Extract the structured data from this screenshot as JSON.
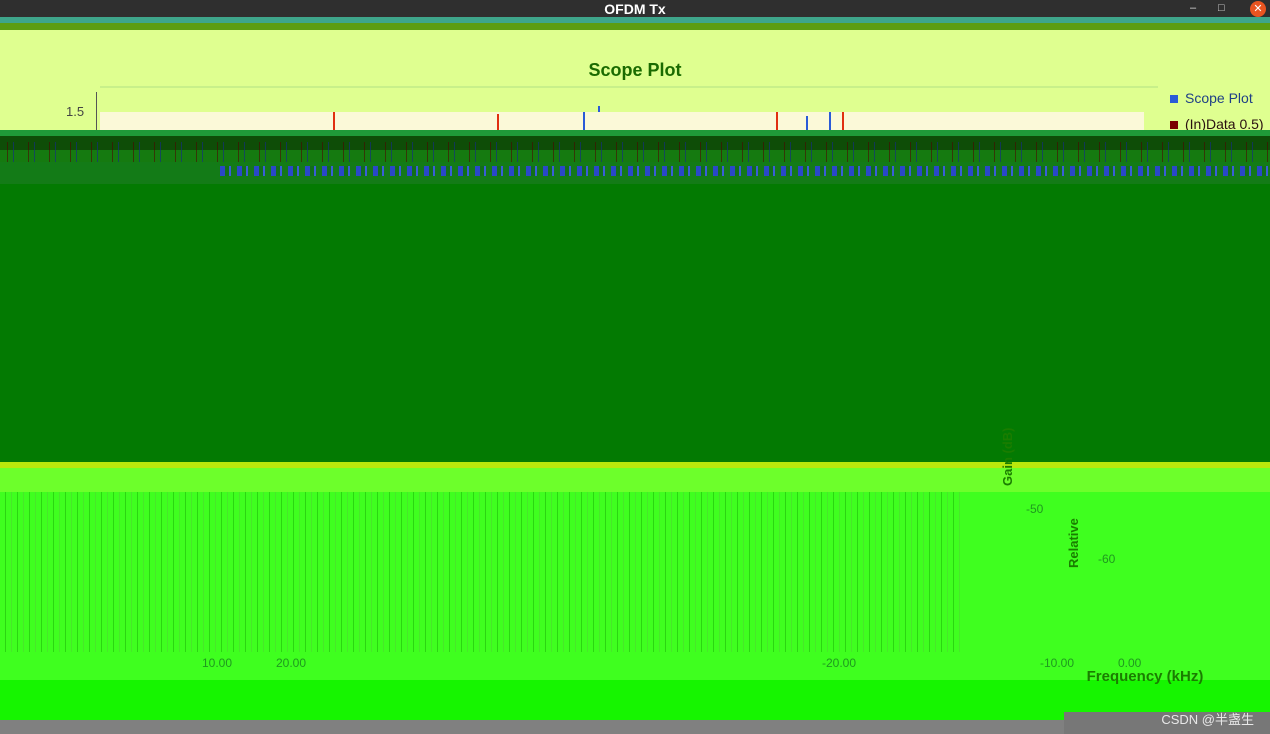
{
  "window": {
    "title": "OFDM Tx",
    "controls": {
      "minimize": "–",
      "maximize": "□",
      "close": "✕"
    }
  },
  "scope": {
    "title": "Scope Plot",
    "y_tick": "1.5",
    "legend": [
      {
        "label": "Scope Plot",
        "color": "#2a5bd7"
      },
      {
        "label": "(In)Data 0.5)",
        "color": "#b01010"
      }
    ]
  },
  "freq_plot": {
    "y_label": "Gain (dB)",
    "y_label_secondary": "Relative",
    "y_ticks": [
      "-50",
      "-60"
    ],
    "x_ticks": [
      "-20.00",
      "-10.00",
      "0.00",
      "10.00",
      "20.00"
    ],
    "x_label": "Frequency (kHz)"
  },
  "watermark": "CSDN @半盏生",
  "colors": {
    "title_green": "#1a6b00",
    "series_blue": "#2a5bd7",
    "series_red": "#e03010",
    "series_dark_red": "#7a0000"
  }
}
